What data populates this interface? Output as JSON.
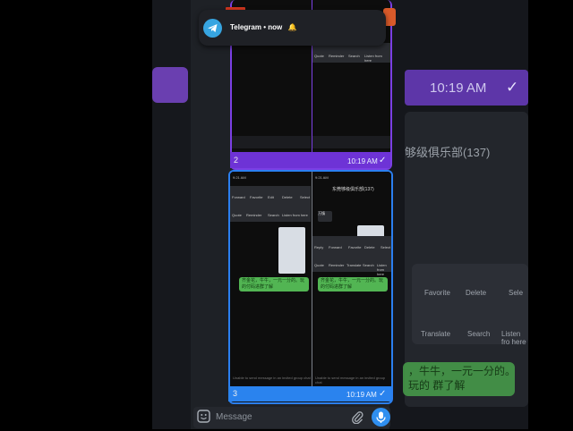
{
  "notification": {
    "app": "Telegram",
    "time": "now",
    "text": "Telegram • now"
  },
  "colors": {
    "accent_purple": "#6e33d6",
    "accent_blue": "#2a83ee",
    "telegram_blue": "#37a5e1",
    "message_green": "#52b553"
  },
  "cards": [
    {
      "index": "2",
      "time": "10:19 AM",
      "check": "✓",
      "menu": [
        "Quote",
        "Reminder",
        "Search",
        "Listen from here"
      ]
    },
    {
      "index": "3",
      "time": "10:19 AM",
      "check": "✓",
      "left_pane": {
        "status_time": "9:21 AM",
        "menu_row1": [
          "Forward",
          "Favorite",
          "Edit",
          "Delete",
          "Select"
        ],
        "menu_row2": [
          "Quote",
          "Reminder",
          "Search",
          "Listen from here"
        ],
        "message": "齐金花，牛牛，一元一分的。玩的付码进群了解",
        "notice": "Unable to send message in an invited group chat"
      },
      "right_pane": {
        "status_time": "9:21 AM",
        "chat_title": "东莞够级俱乐部(137)",
        "bubble_a": "万镇",
        "menu_row1": [
          "Reply",
          "Forward",
          "Favorite",
          "Delete",
          "Select"
        ],
        "menu_row2": [
          "Quote",
          "Reminder",
          "Translate",
          "Search",
          "Listen from here"
        ],
        "message": "齐金花，牛牛，一元一分的。玩的付码进群了解",
        "notice": "Unable to send message in an invited group chat"
      }
    }
  ],
  "background_right": {
    "time": "10:19 AM",
    "check": "✓",
    "chat_title": "够级俱乐部(137)",
    "menu": [
      "Favorite",
      "Delete",
      "Sele",
      "Translate",
      "Search",
      "Listen fro here"
    ],
    "message": "，牛牛，一元一分的。玩的 群了解"
  },
  "compose": {
    "placeholder": "Message",
    "icons": [
      "sticker-icon",
      "attach-icon",
      "mic-icon"
    ]
  }
}
